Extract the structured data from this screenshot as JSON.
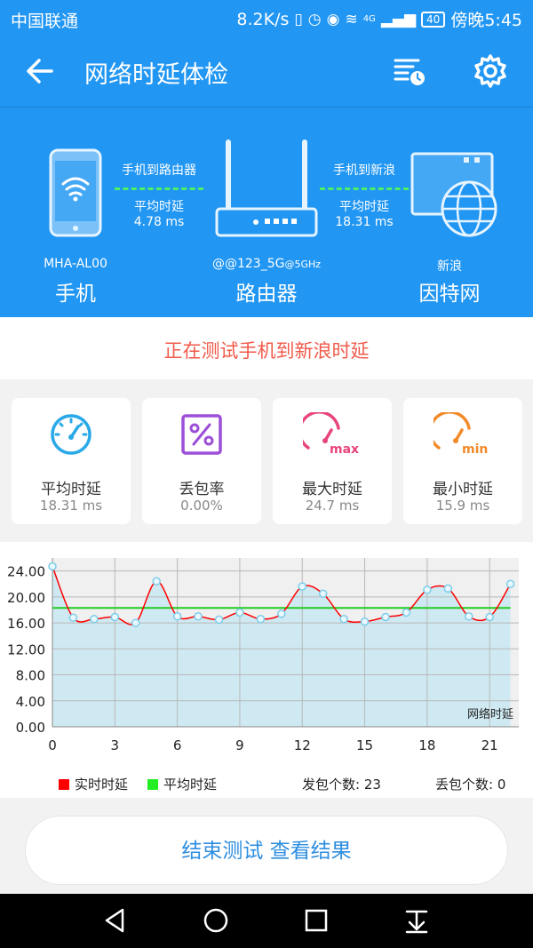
{
  "status_bar": {
    "carrier": "中国联通",
    "speed": "8.2K/s",
    "battery": "40",
    "time": "傍晚5:45",
    "network_badge": "4G"
  },
  "toolbar": {
    "title": "网络时延体检",
    "back_icon": "arrow-left-icon",
    "history_icon": "history-list-icon",
    "settings_icon": "gear-icon"
  },
  "topology": {
    "phone": {
      "sub": "MHA-AL00",
      "name": "手机"
    },
    "router": {
      "sub": "@@123_5G",
      "sub_badge": "@5GHz",
      "name": "路由器"
    },
    "internet": {
      "sub": "新浪",
      "name": "因特网"
    },
    "link1": {
      "label": "手机到路由器",
      "avg_label": "平均时延",
      "value": "4.78 ms"
    },
    "link2": {
      "label": "手机到新浪",
      "avg_label": "平均时延",
      "value": "18.31 ms"
    }
  },
  "current_test": "正在测试手机到新浪时延",
  "stats": [
    {
      "label": "平均时延",
      "value": "18.31 ms",
      "icon": "speedometer-icon"
    },
    {
      "label": "丢包率",
      "value": "0.00%",
      "icon": "percent-icon"
    },
    {
      "label": "最大时延",
      "value": "24.7 ms",
      "icon": "gauge-max-icon"
    },
    {
      "label": "最小时延",
      "value": "15.9 ms",
      "icon": "gauge-min-icon"
    }
  ],
  "chart_data": {
    "type": "line",
    "x": [
      0,
      1,
      2,
      3,
      4,
      5,
      6,
      7,
      8,
      9,
      10,
      11,
      12,
      13,
      14,
      15,
      16,
      17,
      18,
      19,
      20,
      21,
      22
    ],
    "series": [
      {
        "name": "实时时延",
        "values": [
          24.7,
          16.8,
          16.6,
          16.9,
          16.0,
          22.4,
          17.0,
          17.0,
          16.5,
          17.6,
          16.6,
          17.4,
          21.6,
          20.5,
          16.6,
          16.2,
          16.9,
          17.6,
          21.1,
          21.3,
          17.0,
          16.9,
          22.0
        ]
      },
      {
        "name": "平均时延",
        "values": [
          18.31,
          18.31,
          18.31,
          18.31,
          18.31,
          18.31,
          18.31,
          18.31,
          18.31,
          18.31,
          18.31,
          18.31,
          18.31,
          18.31,
          18.31,
          18.31,
          18.31,
          18.31,
          18.31,
          18.31,
          18.31,
          18.31,
          18.31
        ]
      }
    ],
    "xticks": [
      "0",
      "3",
      "6",
      "9",
      "12",
      "15",
      "18",
      "21"
    ],
    "yticks": [
      "0.00",
      "4.00",
      "8.00",
      "12.00",
      "16.00",
      "20.00",
      "24.00"
    ],
    "xlim": [
      0,
      22.4
    ],
    "ylim": [
      0,
      26
    ],
    "chart_label": "网络时延",
    "grid": true,
    "colors": {
      "realtime": "#ff0000",
      "average": "#22cc22",
      "fill": "#cfe9f2"
    }
  },
  "legend": {
    "realtime": "实时时延",
    "average": "平均时延",
    "sent": "发包个数: 23",
    "lost": "丢包个数: 0"
  },
  "finish_button": "结束测试  查看结果",
  "nav": {
    "back": "nav-back-icon",
    "home": "nav-home-icon",
    "recent": "nav-recent-icon",
    "notif": "nav-notification-icon"
  }
}
